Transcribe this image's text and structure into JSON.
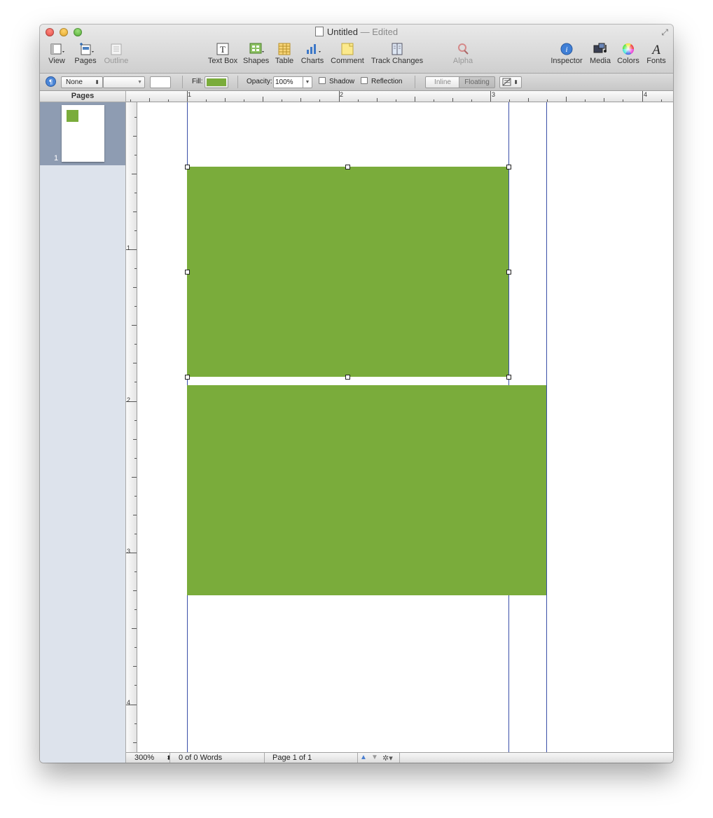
{
  "window": {
    "title": "Untitled",
    "status": "— Edited"
  },
  "toolbar": {
    "view": "View",
    "pages": "Pages",
    "outline": "Outline",
    "text_box": "Text Box",
    "shapes": "Shapes",
    "table": "Table",
    "charts": "Charts",
    "comment": "Comment",
    "track_changes": "Track Changes",
    "alpha": "Alpha",
    "inspector": "Inspector",
    "media": "Media",
    "colors": "Colors",
    "fonts": "Fonts"
  },
  "format_bar": {
    "line_style": "None",
    "fill_label": "Fill:",
    "fill_color": "#7aac3b",
    "opacity_label": "Opacity:",
    "opacity_value": "100%",
    "shadow_label": "Shadow",
    "reflection_label": "Reflection",
    "inline_label": "Inline",
    "floating_label": "Floating"
  },
  "sidebar": {
    "header": "Pages",
    "thumbnails": [
      {
        "page_number": "1"
      }
    ]
  },
  "rulers": {
    "horizontal_labels": [
      "1",
      "2",
      "3",
      "4"
    ],
    "vertical_labels": [
      "1",
      "2",
      "3",
      "4"
    ]
  },
  "document": {
    "shape_color": "#7aac3b",
    "guide_color": "#3b4fa8"
  },
  "status_bar": {
    "zoom": "300%",
    "word_count": "0 of 0 Words",
    "page_info": "Page 1 of 1"
  }
}
